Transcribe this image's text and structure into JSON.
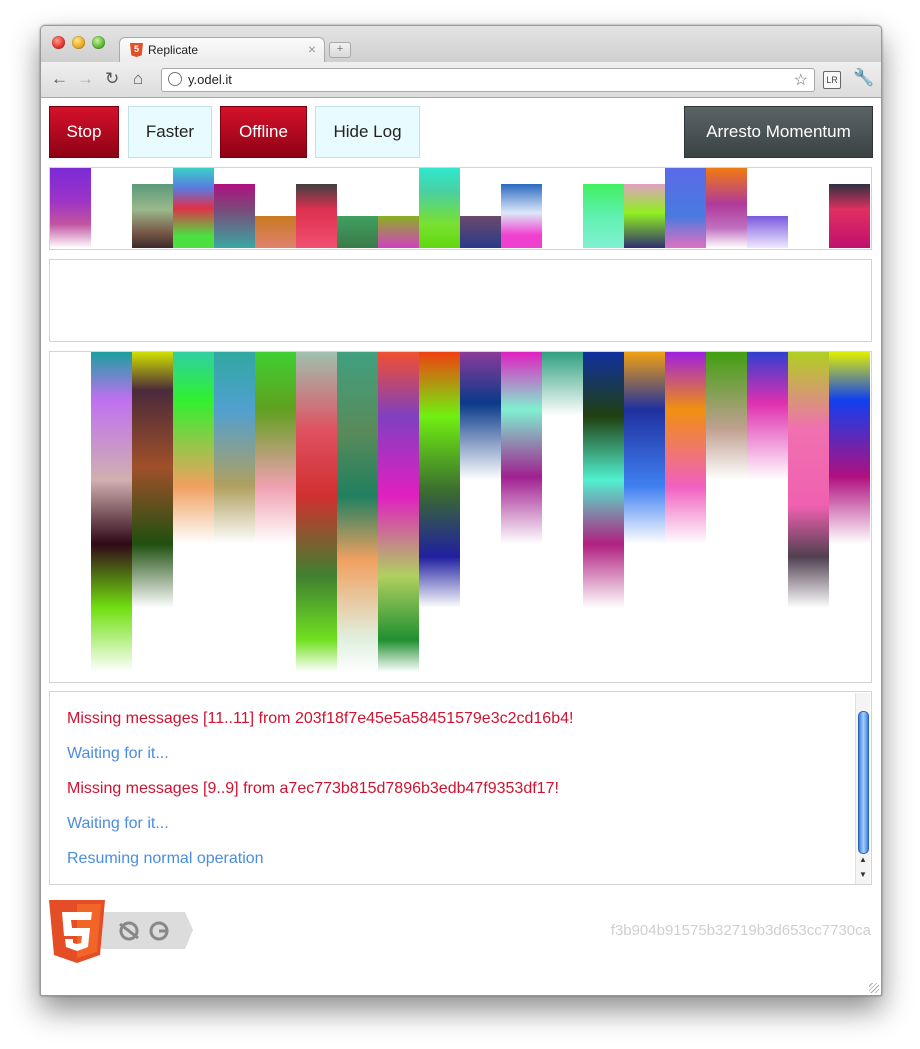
{
  "browser": {
    "tab_title": "Replicate",
    "url": "y.odel.it",
    "tab_close": "×",
    "new_tab": "+",
    "favicon_text": "5"
  },
  "controls": {
    "stop": "Stop",
    "faster": "Faster",
    "offline": "Offline",
    "hide_log": "Hide Log",
    "arresto": "Arresto Momentum"
  },
  "log": [
    {
      "text": "Missing messages [11..11] from 203f18f7e45e5a58451579e3c2cd16b4!",
      "type": "error"
    },
    {
      "text": "Waiting for it...",
      "type": "info"
    },
    {
      "text": "Missing messages [9..9] from a7ec773b815d7896b3edb47f9353df17!",
      "type": "error"
    },
    {
      "text": "Waiting for it...",
      "type": "info"
    },
    {
      "text": "Resuming normal operation",
      "type": "info"
    }
  ],
  "colors": {
    "error": "#d1112f",
    "info": "#4a8de0"
  },
  "footer": {
    "hash": "f3b904b91575b32719b3d653cc7730ca",
    "logo_number": "5"
  },
  "icons": [
    "back-arrow-icon",
    "forward-arrow-icon",
    "reload-icon",
    "home-icon",
    "globe-icon",
    "bookmark-star-icon",
    "extension-icon",
    "wrench-icon",
    "html5-logo-icon",
    "offline-storage-icon",
    "connectivity-icon"
  ]
}
